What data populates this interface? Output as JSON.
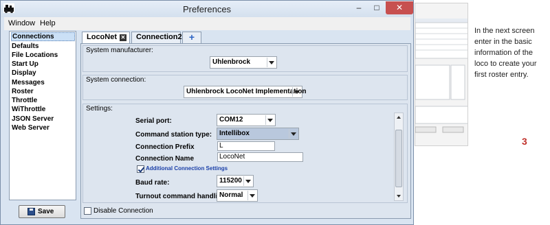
{
  "window": {
    "title": "Preferences",
    "controls": {
      "minimize": "–",
      "maximize": "□",
      "close": "✕"
    }
  },
  "menu": {
    "items": [
      "Window",
      "Help"
    ]
  },
  "sidebar": {
    "items": [
      {
        "label": "Connections",
        "selected": true
      },
      {
        "label": "Defaults"
      },
      {
        "label": "File Locations"
      },
      {
        "label": "Start Up"
      },
      {
        "label": "Display"
      },
      {
        "label": "Messages"
      },
      {
        "label": "Roster"
      },
      {
        "label": "Throttle"
      },
      {
        "label": "WiThrottle"
      },
      {
        "label": "JSON Server"
      },
      {
        "label": "Web Server"
      }
    ],
    "save_label": "Save"
  },
  "tabs": [
    {
      "label": "LocoNet",
      "active": true,
      "close": "✕"
    },
    {
      "label": "Connection2",
      "active": false
    },
    {
      "label": "+",
      "add": true
    }
  ],
  "system_manufacturer": {
    "label": "System manufacturer:",
    "value": "Uhlenbrock"
  },
  "system_connection": {
    "label": "System connection:",
    "value": "Uhlenbrock LocoNet Implementation"
  },
  "settings": {
    "label": "Settings:",
    "serial_port": {
      "label": "Serial port:",
      "value": "COM12"
    },
    "command_station": {
      "label": "Command station type:",
      "value": "Intellibox"
    },
    "connection_prefix": {
      "label": "Connection Prefix",
      "value": "L"
    },
    "connection_name": {
      "label": "Connection Name",
      "value": "LocoNet"
    },
    "additional_settings": {
      "label": "Additional Connection Settings",
      "checked": true
    },
    "baud_rate": {
      "label": "Baud rate:",
      "value": "115200"
    },
    "turnout_handling": {
      "label": "Turnout command handling:",
      "value": "Normal"
    }
  },
  "disable_connection": {
    "label": "Disable Connection",
    "checked": false
  },
  "annotation": {
    "text": "In the next screen enter in the basic information of the loco to create your first roster entry.",
    "page_number": "3",
    "accent": "#c0302a"
  }
}
